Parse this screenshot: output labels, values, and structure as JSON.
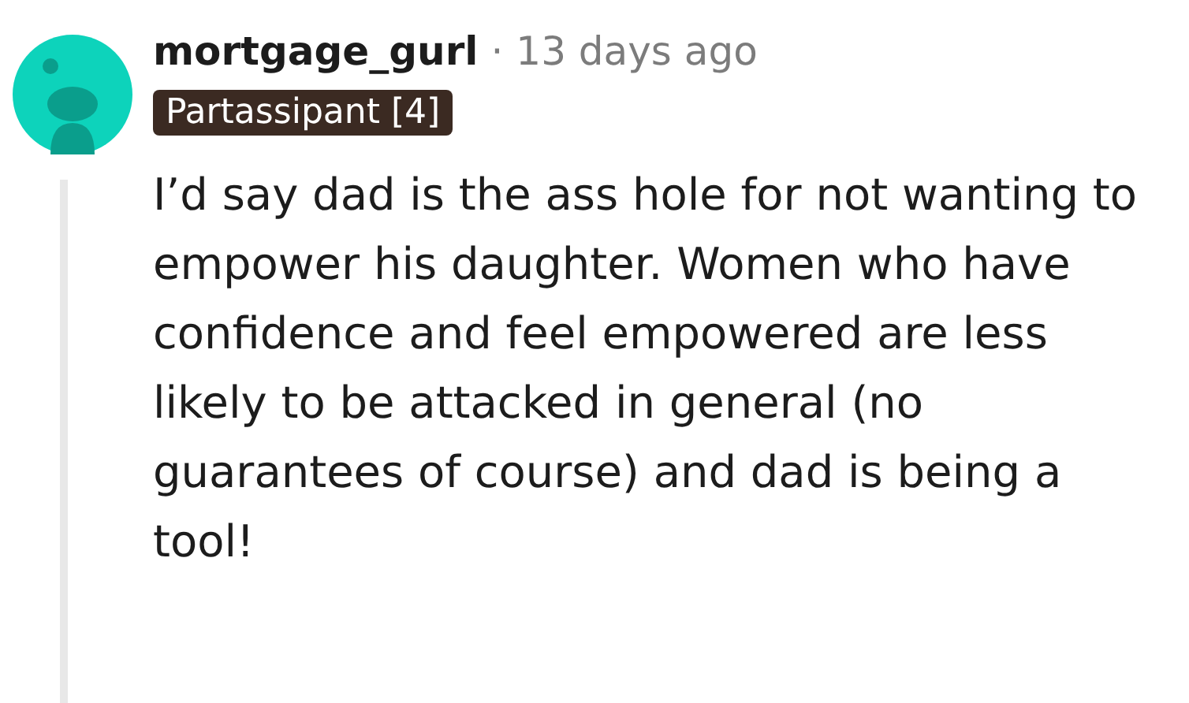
{
  "comment": {
    "username": "mortgage_gurl",
    "separator": "·",
    "time": "13 days ago",
    "flair": "Partassipant [4]",
    "body": "I’d say dad is the ass hole for not wanting to empower his daughter. Women who have confidence and feel empowered are less likely to be attacked in general (no guarantees of course) and dad is being a tool!"
  }
}
